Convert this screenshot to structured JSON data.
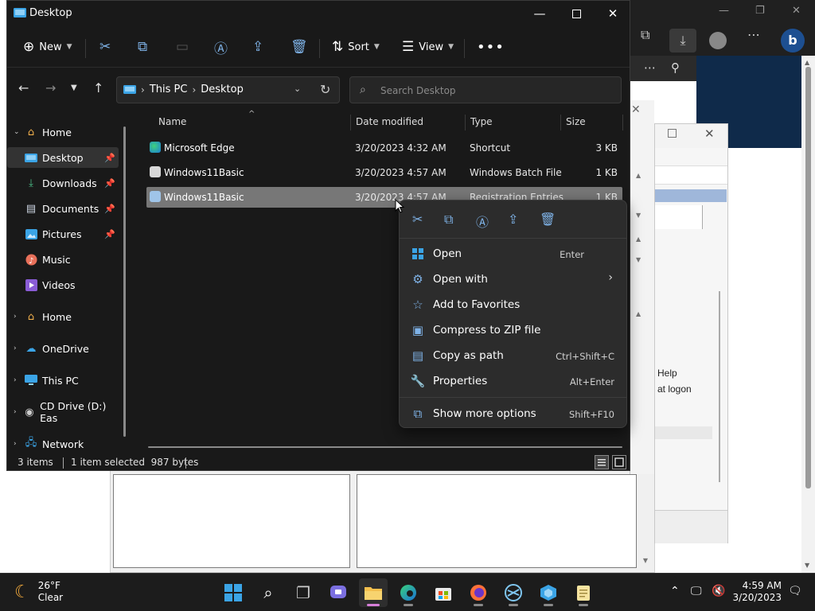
{
  "window": {
    "title": "Desktop"
  },
  "toolbar": {
    "new_label": "New",
    "sort_label": "Sort",
    "view_label": "View"
  },
  "address": {
    "segments": [
      "This PC",
      "Desktop"
    ]
  },
  "search": {
    "placeholder": "Search Desktop"
  },
  "sidebar": {
    "items": [
      {
        "label": "Home",
        "icon": "home-icon"
      },
      {
        "label": "Desktop",
        "icon": "desktop-icon",
        "pinned": true
      },
      {
        "label": "Downloads",
        "icon": "download-icon",
        "pinned": true
      },
      {
        "label": "Documents",
        "icon": "document-icon",
        "pinned": true
      },
      {
        "label": "Pictures",
        "icon": "pictures-icon",
        "pinned": true
      },
      {
        "label": "Music",
        "icon": "music-icon"
      },
      {
        "label": "Videos",
        "icon": "video-icon"
      },
      {
        "label": "Home",
        "icon": "home-icon"
      },
      {
        "label": "OneDrive",
        "icon": "cloud-icon"
      },
      {
        "label": "This PC",
        "icon": "computer-icon"
      },
      {
        "label": "CD Drive (D:) Eas",
        "icon": "cd-drive-icon"
      },
      {
        "label": "Network",
        "icon": "network-icon"
      }
    ]
  },
  "columns": {
    "name": "Name",
    "date": "Date modified",
    "type": "Type",
    "size": "Size"
  },
  "files": [
    {
      "name": "Microsoft Edge",
      "date": "3/20/2023 4:32 AM",
      "type": "Shortcut",
      "size": "3 KB"
    },
    {
      "name": "Windows11Basic",
      "date": "3/20/2023 4:57 AM",
      "type": "Windows Batch File",
      "size": "1 KB"
    },
    {
      "name": "Windows11Basic",
      "date": "3/20/2023 4:57 AM",
      "type": "Registration Entries",
      "size": "1 KB"
    }
  ],
  "status": {
    "count": "3 items",
    "selection": "1 item selected  987 bytes"
  },
  "context_menu": {
    "items": [
      {
        "label": "Open",
        "shortcut": "Enter",
        "icon": "open-icon"
      },
      {
        "label": "Open with",
        "shortcut": "",
        "icon": "open-with-icon"
      },
      {
        "label": "Add to Favorites",
        "shortcut": "",
        "icon": "star-icon"
      },
      {
        "label": "Compress to ZIP file",
        "shortcut": "",
        "icon": "zip-icon"
      },
      {
        "label": "Copy as path",
        "shortcut": "Ctrl+Shift+C",
        "icon": "copy-path-icon"
      },
      {
        "label": "Properties",
        "shortcut": "Alt+Enter",
        "icon": "wrench-icon"
      },
      {
        "label": "Show more options",
        "shortcut": "Shift+F10",
        "icon": "more-options-icon"
      }
    ]
  },
  "background": {
    "dlg_line1": "Help",
    "dlg_line2": "at logon"
  },
  "taskbar": {
    "weather_temp": "26°F",
    "weather_desc": "Clear",
    "time": "4:59 AM",
    "date": "3/20/2023"
  },
  "colors": {
    "accent": "#7fb3e8",
    "selected_row": "#777777",
    "window_bg": "#191919",
    "menu_bg": "#2c2c2c"
  }
}
